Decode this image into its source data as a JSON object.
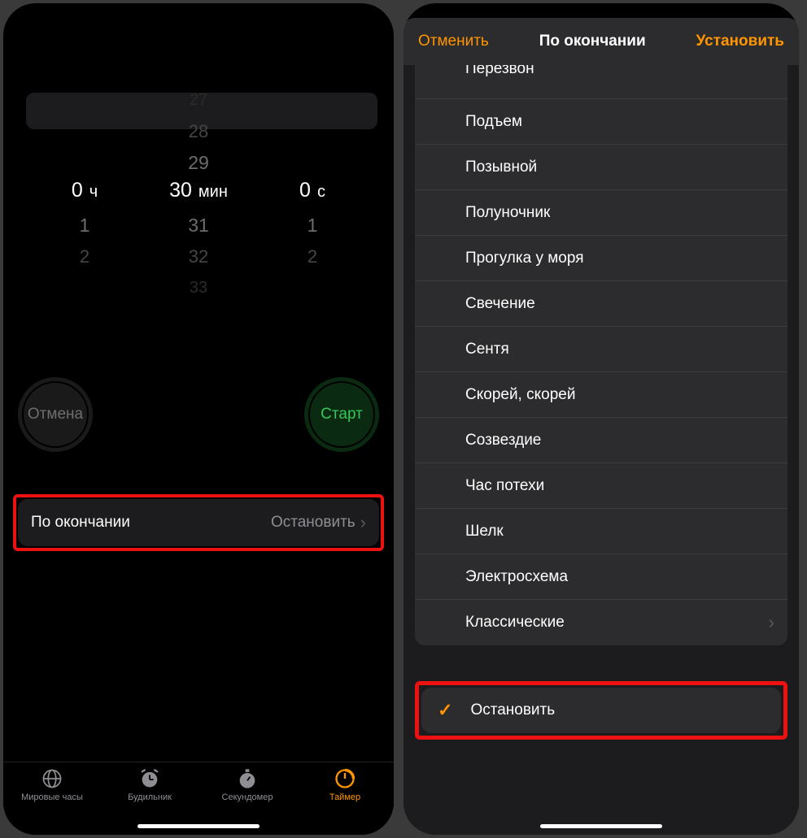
{
  "left": {
    "picker": {
      "hours": {
        "above": [
          "",
          "",
          ""
        ],
        "selected": "0",
        "unit": "ч",
        "below": [
          "1",
          "2",
          ""
        ]
      },
      "minutes": {
        "above": [
          "27",
          "28",
          "29"
        ],
        "selected": "30",
        "unit": "мин",
        "below": [
          "31",
          "32",
          "33"
        ]
      },
      "seconds": {
        "above": [
          "",
          "",
          ""
        ],
        "selected": "0",
        "unit": "с",
        "below": [
          "1",
          "2",
          ""
        ]
      }
    },
    "cancel_label": "Отмена",
    "start_label": "Старт",
    "setting": {
      "label": "По окончании",
      "value": "Остановить"
    },
    "tabs": [
      {
        "label": "Мировые часы"
      },
      {
        "label": "Будильник"
      },
      {
        "label": "Секундомер"
      },
      {
        "label": "Таймер"
      }
    ]
  },
  "right": {
    "header": {
      "cancel": "Отменить",
      "title": "По окончании",
      "set": "Установить"
    },
    "sounds": [
      "Перезвон",
      "Подъем",
      "Позывной",
      "Полуночник",
      "Прогулка у моря",
      "Свечение",
      "Сентя",
      "Скорей, скорей",
      "Созвездие",
      "Час потехи",
      "Шелк",
      "Электросхема"
    ],
    "classic_label": "Классические",
    "stop_label": "Остановить"
  }
}
